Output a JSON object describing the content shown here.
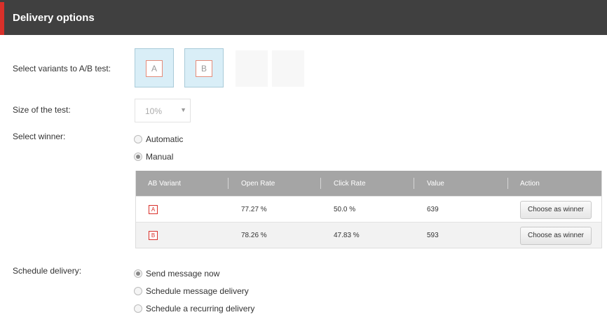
{
  "header": {
    "title": "Delivery options",
    "accent_color": "#d9302a",
    "background": "#404040"
  },
  "variants": {
    "label": "Select variants to A/B test:",
    "items": [
      {
        "letter": "A"
      },
      {
        "letter": "B"
      }
    ]
  },
  "test_size": {
    "label": "Size of the test:",
    "value": "10%"
  },
  "winner": {
    "label": "Select winner:",
    "options": [
      {
        "label": "Automatic",
        "selected": false
      },
      {
        "label": "Manual",
        "selected": true
      }
    ]
  },
  "table": {
    "columns": [
      "AB Variant",
      "Open Rate",
      "Click Rate",
      "Value",
      "Action"
    ],
    "rows": [
      {
        "variant": "A",
        "open_rate": "77.27 %",
        "click_rate": "50.0 %",
        "value": "639",
        "action": "Choose as winner"
      },
      {
        "variant": "B",
        "open_rate": "78.26 %",
        "click_rate": "47.83 %",
        "value": "593",
        "action": "Choose as winner"
      }
    ]
  },
  "schedule": {
    "label": "Schedule delivery:",
    "options": [
      {
        "label": "Send message now",
        "selected": true
      },
      {
        "label": "Schedule message delivery",
        "selected": false
      },
      {
        "label": "Schedule a recurring delivery",
        "selected": false
      }
    ]
  }
}
